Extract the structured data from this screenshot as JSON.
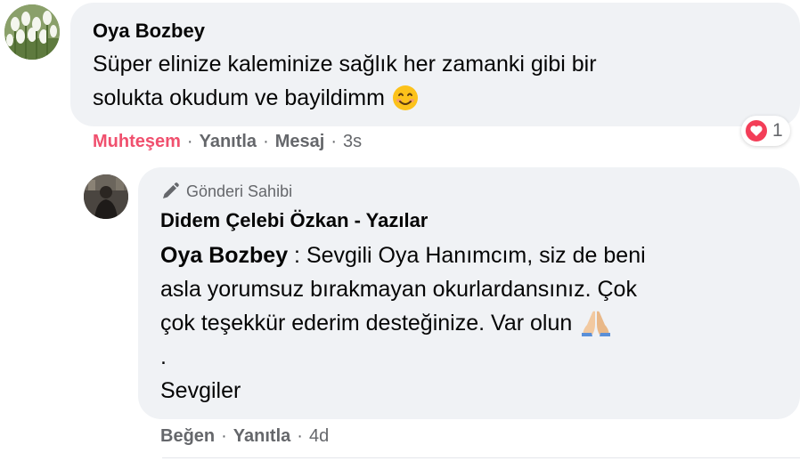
{
  "comment": {
    "author": "Oya Bozbey",
    "text_line1": "Süper elinize kaleminize sağlık her zamanki gibi bir",
    "text_line2": "solukta okudum ve bayildimm",
    "emoji_icon": "smiling-face-icon",
    "actions": {
      "reaction_label": "Muhteşem",
      "reply_label": "Yanıtla",
      "message_label": "Mesaj",
      "time": "3s"
    },
    "reaction_count": "1",
    "reaction_icon": "love-heart-icon"
  },
  "reply": {
    "badge_label": "Gönderi Sahibi",
    "badge_icon": "pencil-icon",
    "author": "Didem Çelebi Özkan - Yazılar",
    "mention": "Oya Bozbey",
    "text_line1": " : Sevgili Oya Hanımcım, siz de beni",
    "text_line2": "asla yorumsuz bırakmayan okurlardansınız. Çok",
    "text_line3": "çok teşekkür ederim desteğinize. Var olun",
    "emoji_icon": "folded-hands-icon",
    "text_line4": ".",
    "text_line5": "Sevgiler",
    "actions": {
      "like_label": "Beğen",
      "reply_label": "Yanıtla",
      "time": "4d"
    }
  },
  "colors": {
    "bubble": "#f0f2f5",
    "secondary_text": "#65676b",
    "reaction_accent": "#f0506e"
  }
}
